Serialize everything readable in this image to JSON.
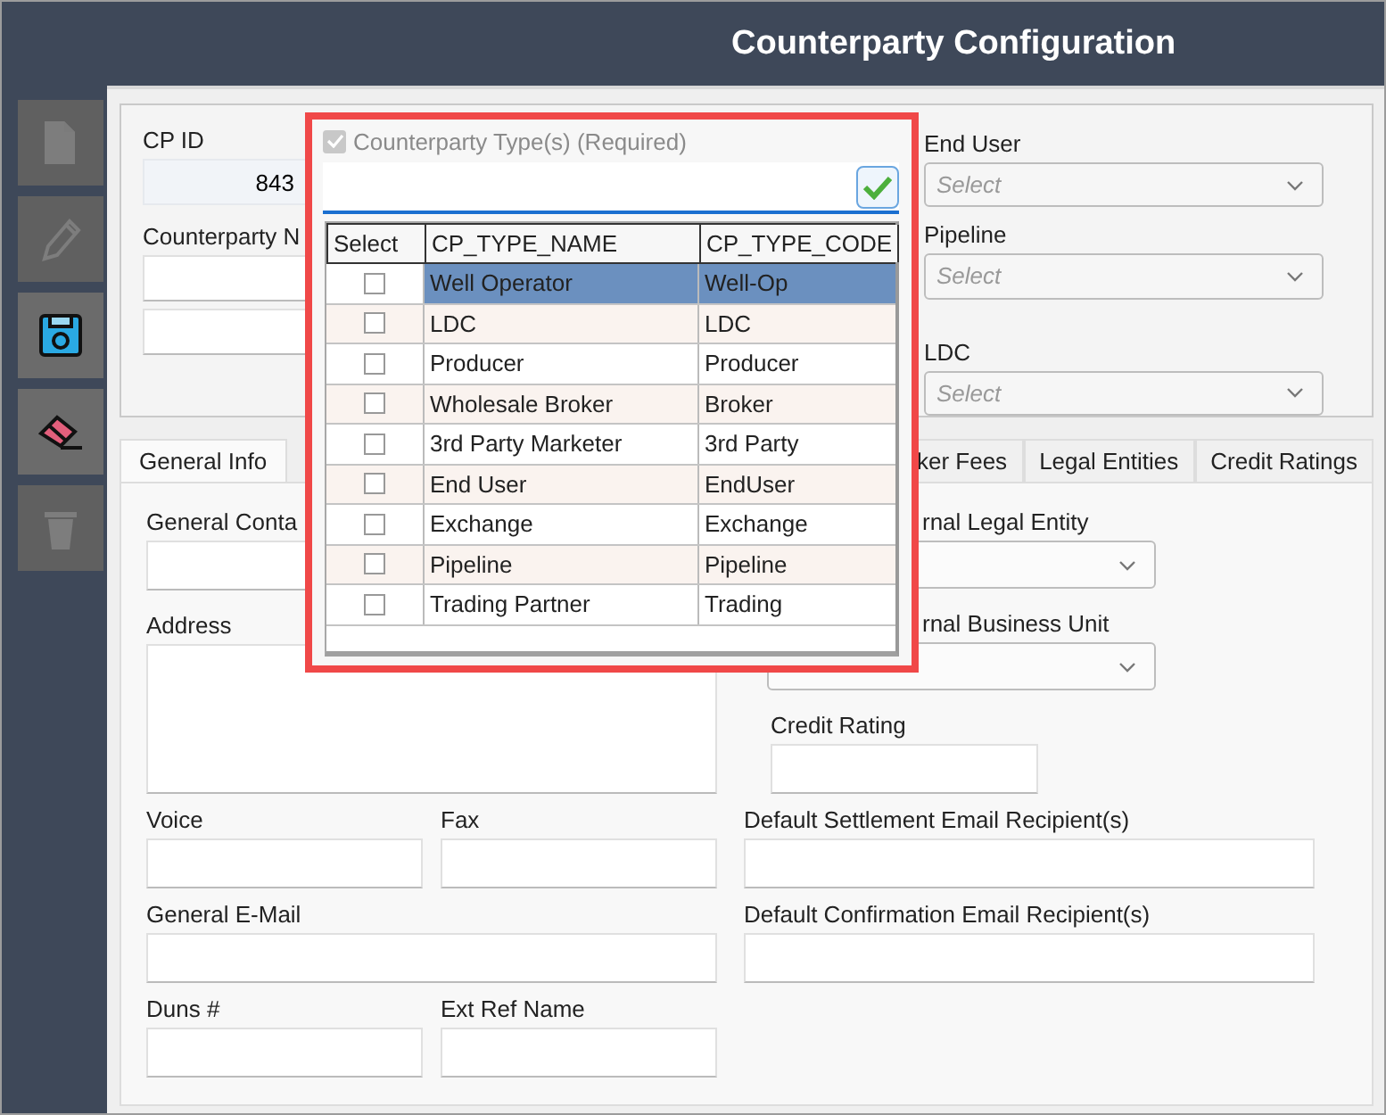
{
  "window": {
    "title": "Counterparty Configuration"
  },
  "toolbar": [
    {
      "kind": "new",
      "disabled": true
    },
    {
      "kind": "edit",
      "disabled": true
    },
    {
      "kind": "save",
      "disabled": false
    },
    {
      "kind": "clear",
      "disabled": false
    },
    {
      "kind": "delete",
      "disabled": true
    }
  ],
  "header": {
    "cp_id": {
      "label": "CP ID",
      "value": "843"
    },
    "counterparty_name": {
      "label": "Counterparty N"
    },
    "selects": [
      {
        "label": "End User",
        "placeholder": "Select"
      },
      {
        "label": "Pipeline",
        "placeholder": "Select"
      },
      {
        "label": "LDC",
        "placeholder": "Select"
      }
    ]
  },
  "tabs": [
    {
      "label": "General Info",
      "selected": true
    },
    {
      "label": "ker Fees",
      "selected": false
    },
    {
      "label": "Legal Entities",
      "selected": false
    },
    {
      "label": "Credit Ratings",
      "selected": false
    }
  ],
  "general_info": {
    "general_contact": {
      "label": "General Conta"
    },
    "address": {
      "label": "Address"
    },
    "voice": {
      "label": "Voice"
    },
    "fax": {
      "label": "Fax"
    },
    "general_email": {
      "label": "General E-Mail"
    },
    "duns": {
      "label": "Duns #"
    },
    "ext_ref_name": {
      "label": "Ext Ref Name"
    },
    "legal_entity": {
      "label": "rnal Legal Entity"
    },
    "business_unit": {
      "label": "rnal Business Unit"
    },
    "credit_rating": {
      "label": "Credit Rating"
    },
    "settlement_email": {
      "label": "Default Settlement Email Recipient(s)"
    },
    "confirmation_email": {
      "label": "Default Confirmation Email Recipient(s)"
    }
  },
  "type_picker": {
    "toggle": {
      "label": "Counterparty Type(s) (Required)",
      "checked": true,
      "disabled": true
    },
    "columns": [
      "Select",
      "CP_TYPE_NAME",
      "CP_TYPE_CODE"
    ],
    "rows": [
      {
        "checked": false,
        "selected": true,
        "name": "Well Operator",
        "code": "Well-Op"
      },
      {
        "checked": false,
        "selected": false,
        "name": "LDC",
        "code": "LDC"
      },
      {
        "checked": false,
        "selected": false,
        "name": "Producer",
        "code": "Producer"
      },
      {
        "checked": false,
        "selected": false,
        "name": "Wholesale Broker",
        "code": "Broker"
      },
      {
        "checked": false,
        "selected": false,
        "name": "3rd Party Marketer",
        "code": "3rd Party"
      },
      {
        "checked": false,
        "selected": false,
        "name": "End User",
        "code": "EndUser"
      },
      {
        "checked": false,
        "selected": false,
        "name": "Exchange",
        "code": "Exchange"
      },
      {
        "checked": false,
        "selected": false,
        "name": "Pipeline",
        "code": "Pipeline"
      },
      {
        "checked": false,
        "selected": false,
        "name": "Trading Partner",
        "code": "Trading"
      }
    ]
  }
}
